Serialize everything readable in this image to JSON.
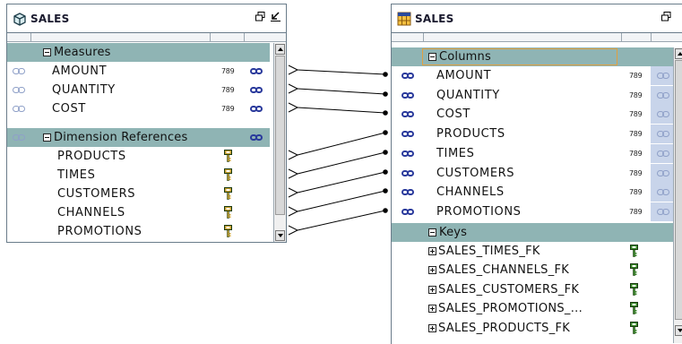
{
  "left_panel": {
    "title": "SALES",
    "icon": "cube-icon",
    "sections": {
      "measures": "Measures",
      "dimension_refs": "Dimension References"
    },
    "measures": [
      {
        "label": "AMOUNT",
        "type": "789"
      },
      {
        "label": "QUANTITY",
        "type": "789"
      },
      {
        "label": "COST",
        "type": "789"
      }
    ],
    "dimension_refs": [
      "PRODUCTS",
      "TIMES",
      "CUSTOMERS",
      "CHANNELS",
      "PROMOTIONS"
    ]
  },
  "right_panel": {
    "title": "SALES",
    "icon": "table-icon",
    "sections": {
      "columns": "Columns",
      "keys": "Keys"
    },
    "columns": [
      {
        "label": "AMOUNT",
        "type": "789"
      },
      {
        "label": "QUANTITY",
        "type": "789"
      },
      {
        "label": "COST",
        "type": "789"
      },
      {
        "label": "PRODUCTS",
        "type": "789"
      },
      {
        "label": "TIMES",
        "type": "789"
      },
      {
        "label": "CUSTOMERS",
        "type": "789"
      },
      {
        "label": "CHANNELS",
        "type": "789"
      },
      {
        "label": "PROMOTIONS",
        "type": "789"
      }
    ],
    "keys": [
      "SALES_TIMES_FK",
      "SALES_CHANNELS_FK",
      "SALES_CUSTOMERS_FK",
      "SALES_PROMOTIONS_...",
      "SALES_PRODUCTS_FK"
    ]
  },
  "colors": {
    "section_bg": "#8fb4b4",
    "link_strong": "#2a3a9c",
    "link_weak": "#8fa0c8",
    "selection_border": "#e0a040"
  }
}
